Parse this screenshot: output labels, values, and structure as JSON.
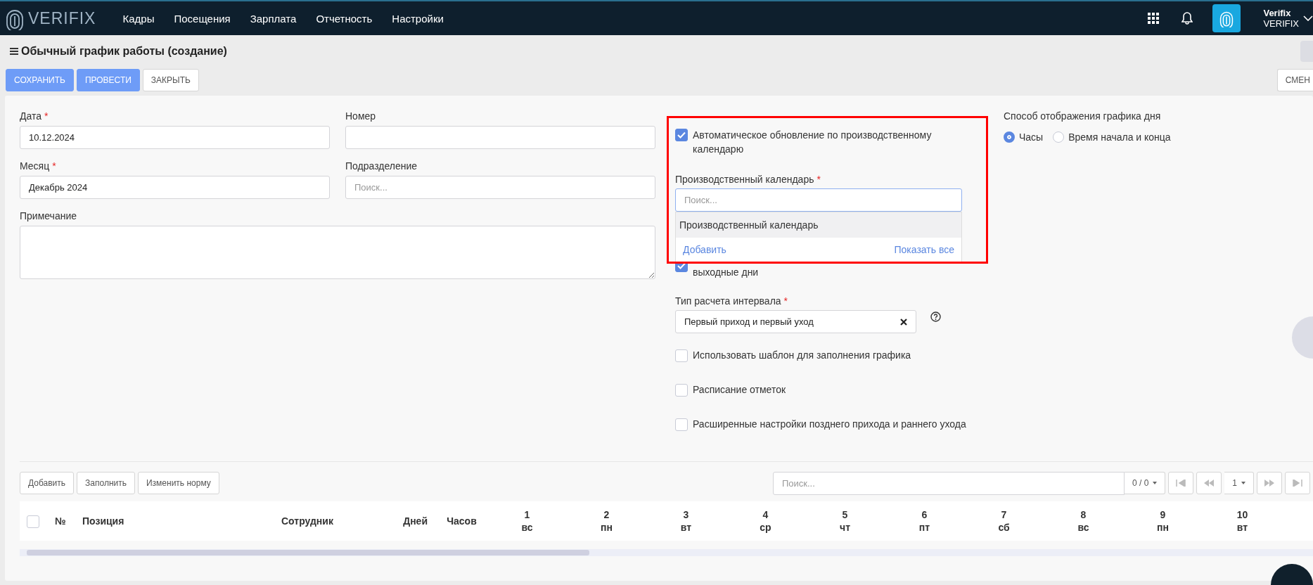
{
  "nav": {
    "logo": "VERIFIX",
    "menu": [
      "Кадры",
      "Посещения",
      "Зарплата",
      "Отчетность",
      "Настройки"
    ],
    "user": {
      "name": "Verifix",
      "company": "VERIFIX"
    }
  },
  "page": {
    "title": "Обычный график работы (создание)"
  },
  "toolbar": {
    "buttons": [
      {
        "label": "СОХРАНИТЬ",
        "kind": "primary"
      },
      {
        "label": "ПРОВЕСТИ",
        "kind": "primary"
      },
      {
        "label": "ЗАКРЫТЬ",
        "kind": "default"
      }
    ],
    "right_button": "СМЕН"
  },
  "left": {
    "date": {
      "label": "Дата",
      "required_mark": "*",
      "value": "10.12.2024"
    },
    "number": {
      "label": "Номер"
    },
    "month": {
      "label": "Месяц",
      "required_mark": "*",
      "value": "Декабрь 2024"
    },
    "division": {
      "label": "Подразделение",
      "placeholder": "Поиск..."
    },
    "note": {
      "label": "Примечание"
    }
  },
  "middle": {
    "auto_update": {
      "label": "Автоматическое обновление по производственному календарю",
      "checked": true
    },
    "calendar": {
      "label": "Производственный календарь",
      "required_mark": "*",
      "placeholder": "Поиск...",
      "dropdown": {
        "items": [
          "Производственный календарь"
        ],
        "add": "Добавить",
        "show_all": "Показать все"
      }
    },
    "holidays": {
      "label": "выходные дни",
      "checked": true
    },
    "interval": {
      "label": "Тип расчета интервала",
      "required_mark": "*",
      "value": "Первый приход и первый уход"
    },
    "options": [
      {
        "label": "Использовать шаблон для заполнения графика",
        "checked": false
      },
      {
        "label": "Расписание отметок",
        "checked": false
      },
      {
        "label": "Расширенные настройки позднего прихода и раннего ухода",
        "checked": false
      }
    ]
  },
  "right": {
    "display_mode": {
      "label": "Способ отображения графика дня",
      "options": [
        {
          "label": "Часы",
          "selected": true
        },
        {
          "label": "Время начала и конца",
          "selected": false
        }
      ]
    }
  },
  "table": {
    "buttons": [
      "Добавить",
      "Заполнить",
      "Изменить норму"
    ],
    "search_placeholder": "Поиск...",
    "count": "0 / 0",
    "page": "1",
    "select_all": false,
    "columns": [
      "№",
      "Позиция",
      "Сотрудник",
      "Дней",
      "Часов"
    ],
    "days": [
      {
        "num": "1",
        "day": "вс"
      },
      {
        "num": "2",
        "day": "пн"
      },
      {
        "num": "3",
        "day": "вт"
      },
      {
        "num": "4",
        "day": "ср"
      },
      {
        "num": "5",
        "day": "чт"
      },
      {
        "num": "6",
        "day": "пт"
      },
      {
        "num": "7",
        "day": "сб"
      },
      {
        "num": "8",
        "day": "вс"
      },
      {
        "num": "9",
        "day": "пн"
      },
      {
        "num": "10",
        "day": "вт"
      }
    ]
  }
}
